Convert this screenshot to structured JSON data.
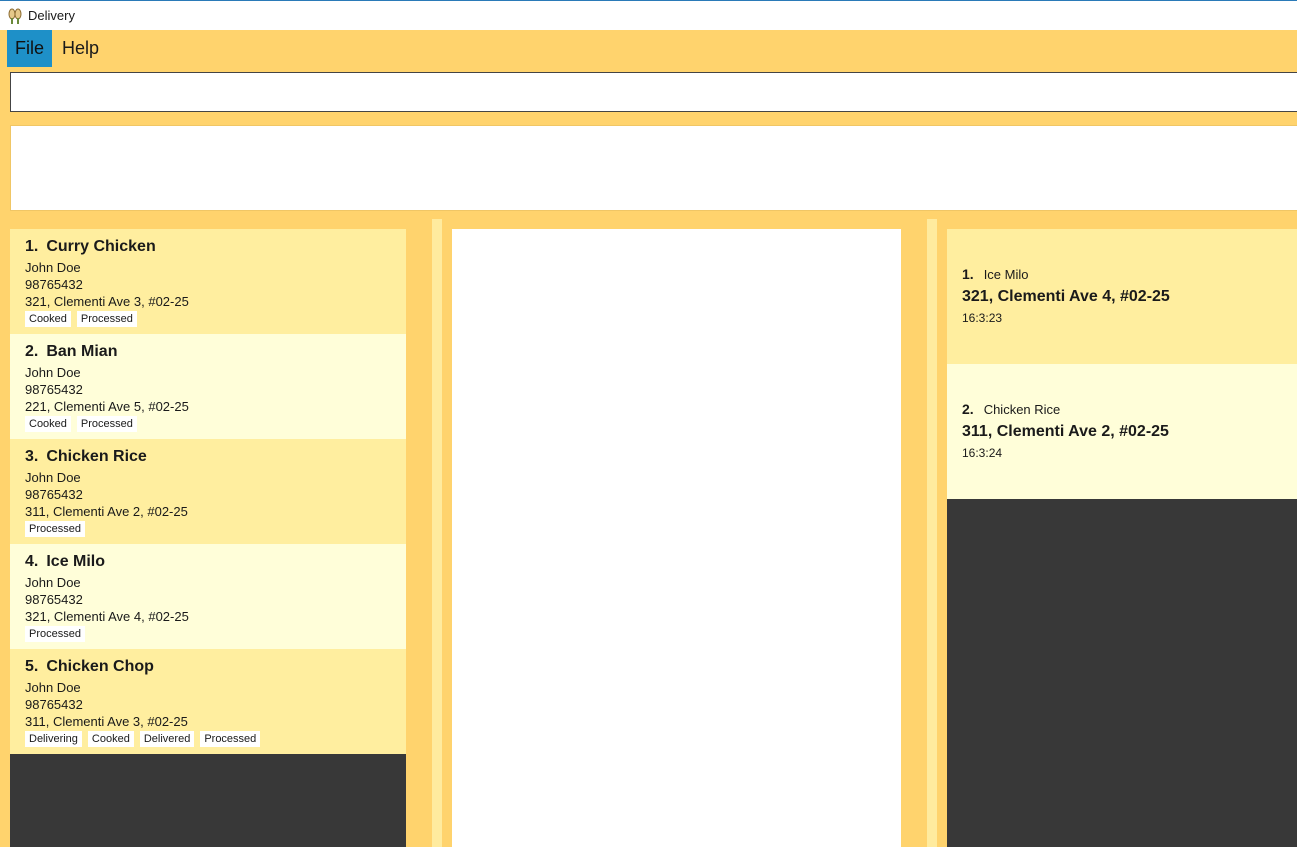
{
  "window": {
    "title": "Delivery"
  },
  "menu": {
    "file": "File",
    "help": "Help"
  },
  "command": {
    "value": "",
    "placeholder": ""
  },
  "result": {
    "text": ""
  },
  "orders": [
    {
      "index": "1.",
      "name": "Curry Chicken",
      "customer": "John Doe",
      "phone": "98765432",
      "address": "321, Clementi Ave 3, #02-25",
      "tags": [
        "Cooked",
        "Processed"
      ]
    },
    {
      "index": "2.",
      "name": "Ban Mian",
      "customer": "John Doe",
      "phone": "98765432",
      "address": "221, Clementi Ave 5, #02-25",
      "tags": [
        "Cooked",
        "Processed"
      ]
    },
    {
      "index": "3.",
      "name": "Chicken Rice",
      "customer": "John Doe",
      "phone": "98765432",
      "address": "311, Clementi Ave 2, #02-25",
      "tags": [
        "Processed"
      ]
    },
    {
      "index": "4.",
      "name": "Ice Milo",
      "customer": "John Doe",
      "phone": "98765432",
      "address": "321, Clementi Ave 4, #02-25",
      "tags": [
        "Processed"
      ]
    },
    {
      "index": "5.",
      "name": "Chicken Chop",
      "customer": "John Doe",
      "phone": "98765432",
      "address": "311, Clementi Ave 3, #02-25",
      "tags": [
        "Delivering",
        "Cooked",
        "Delivered",
        "Processed"
      ]
    }
  ],
  "deliveries": [
    {
      "index": "1.",
      "name": "Ice Milo",
      "address": "321, Clementi Ave 4, #02-25",
      "time": "16:3:23"
    },
    {
      "index": "2.",
      "name": "Chicken Rice",
      "address": "311, Clementi Ave 2, #02-25",
      "time": "16:3:24"
    }
  ],
  "colors": {
    "background": "#ffd36d",
    "card_odd": "#ffee9f",
    "card_even": "#fffed9",
    "empty_list": "#383838",
    "menu_active": "#1e90c8"
  }
}
